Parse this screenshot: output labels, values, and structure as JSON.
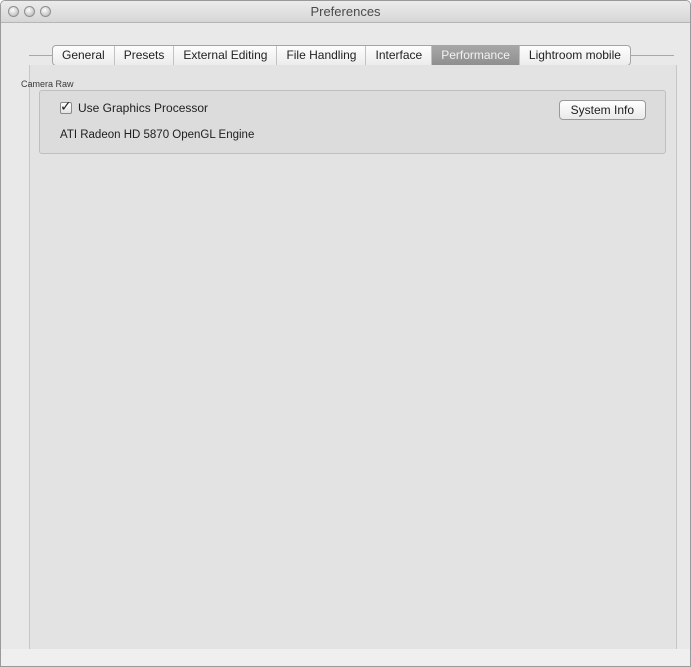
{
  "window": {
    "title": "Preferences"
  },
  "tabs": [
    {
      "label": "General",
      "active": false
    },
    {
      "label": "Presets",
      "active": false
    },
    {
      "label": "External Editing",
      "active": false
    },
    {
      "label": "File Handling",
      "active": false
    },
    {
      "label": "Interface",
      "active": false
    },
    {
      "label": "Performance",
      "active": true
    },
    {
      "label": "Lightroom mobile",
      "active": false
    }
  ],
  "camera_raw": {
    "section_label": "Camera Raw",
    "use_gpu_label": "Use Graphics Processor",
    "use_gpu_checked": true,
    "gpu_info": "ATI Radeon HD 5870 OpenGL Engine",
    "system_info_button": "System Info"
  },
  "icons": {
    "close": "close-icon",
    "minimize": "minimize-icon",
    "zoom": "zoom-icon",
    "checkmark": "checkmark-icon"
  }
}
